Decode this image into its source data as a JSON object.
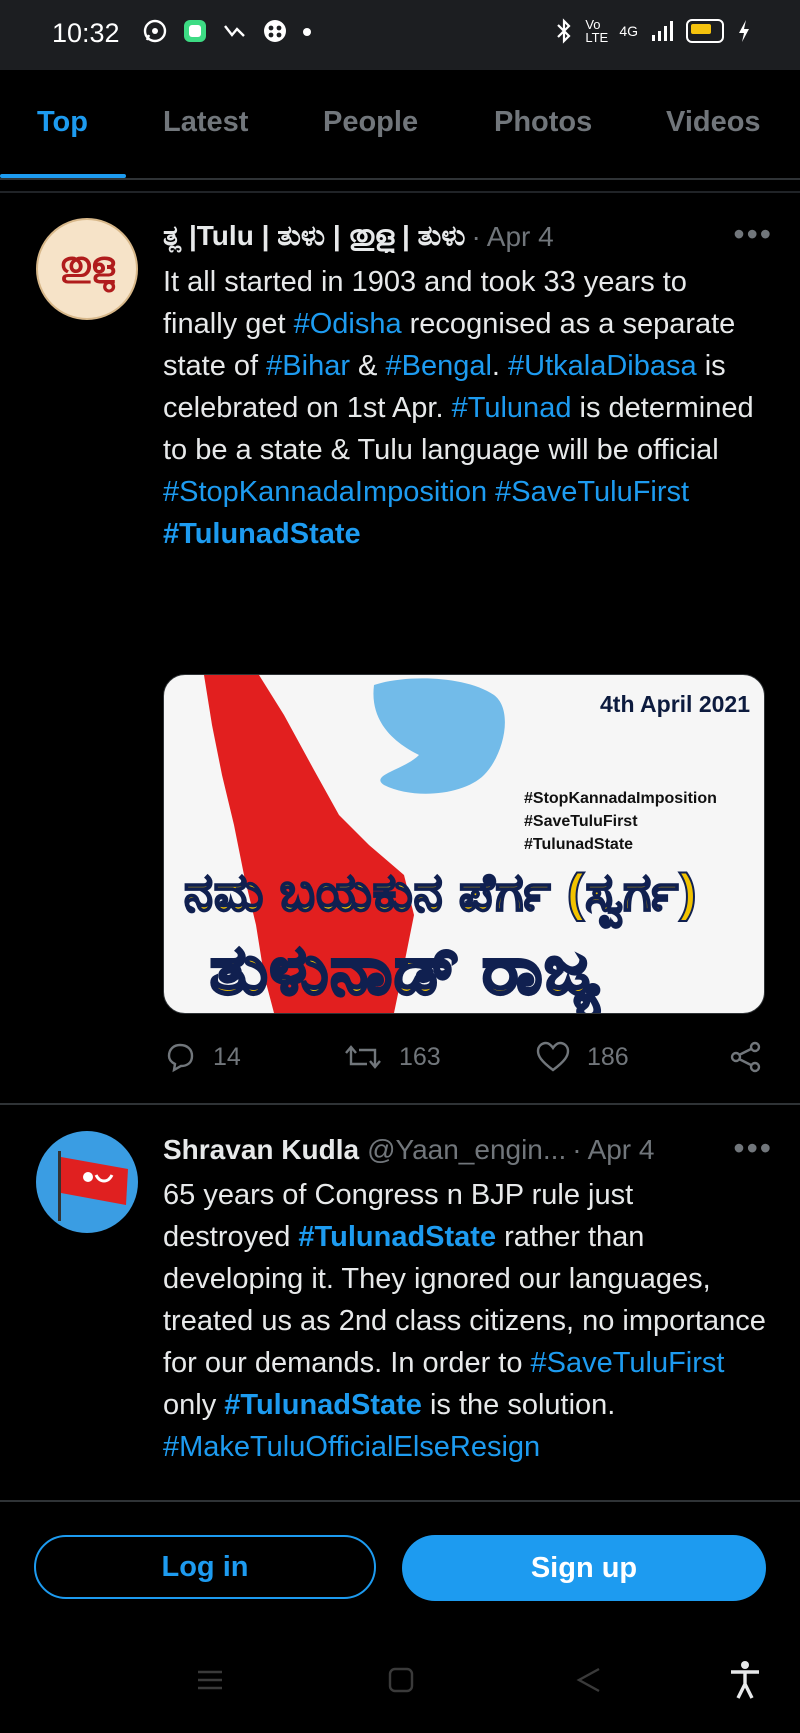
{
  "status_bar": {
    "time": "10:32",
    "network": "4G",
    "volte": "Vo LTE",
    "battery_level": 0.6
  },
  "tabs": [
    {
      "label": "Top",
      "active": true
    },
    {
      "label": "Latest",
      "active": false
    },
    {
      "label": "People",
      "active": false
    },
    {
      "label": "Photos",
      "active": false
    },
    {
      "label": "Videos",
      "active": false
    }
  ],
  "tweets": [
    {
      "name": "ತ್ಲ |Tulu | ತುಳು | തുളു | ತುಳು",
      "handle": "",
      "date": "Apr 4",
      "more": "•••",
      "avatar_text": "തുളു",
      "text_parts": [
        {
          "t": "It all started in 1903 and took 33 years to finally get "
        },
        {
          "t": "#Odisha",
          "h": 1
        },
        {
          "t": " recognised as a separate state of "
        },
        {
          "t": "#Bihar",
          "h": 1
        },
        {
          "t": " & "
        },
        {
          "t": "#Bengal",
          "h": 1
        },
        {
          "t": ". "
        },
        {
          "t": "#UtkalaDibasa",
          "h": 1
        },
        {
          "t": " is celebrated on 1st Apr. "
        },
        {
          "t": "#Tulunad",
          "h": 1
        },
        {
          "t": " is determined to be a state & Tulu language will be official "
        },
        {
          "t": "#StopKannadaImposition",
          "h": 1
        },
        {
          "t": " "
        },
        {
          "t": "#SaveTuluFirst",
          "h": 1
        },
        {
          "t": " "
        },
        {
          "t": "#TulunadState",
          "h": 2
        }
      ],
      "media": {
        "date": "4th April 2021",
        "tags": [
          "#StopKannadaImposition",
          "#SaveTuluFirst",
          "#TulunadState"
        ],
        "line1": "ನಮ ಬಯಕುನ ಪೆರ್ಗ (ಸ್ವರ್ಗ)",
        "line2": "ತುಳುನಾಡ್ ರಾಜ್ಯ"
      },
      "replies": "14",
      "retweets": "163",
      "likes": "186"
    },
    {
      "name": "Shravan Kudla",
      "handle": "@Yaan_engin...",
      "date": "Apr 4",
      "more": "•••",
      "text_parts": [
        {
          "t": "65 years of Congress n BJP rule just destroyed "
        },
        {
          "t": "#TulunadState",
          "h": 2
        },
        {
          "t": "  rather than developing it. They ignored our languages, treated us as 2nd class citizens, no importance for our demands. In order to "
        },
        {
          "t": "#SaveTuluFirst",
          "h": 1
        },
        {
          "t": " only "
        },
        {
          "t": "#TulunadState",
          "h": 2
        },
        {
          "t": " is the solution. "
        },
        {
          "t": "#MakeTuluOfficialElseResign",
          "h": 1
        }
      ]
    }
  ],
  "footer": {
    "login": "Log in",
    "signup": "Sign up"
  },
  "colors": {
    "accent": "#1d9bf0",
    "background": "#000000",
    "muted": "#71767b"
  }
}
